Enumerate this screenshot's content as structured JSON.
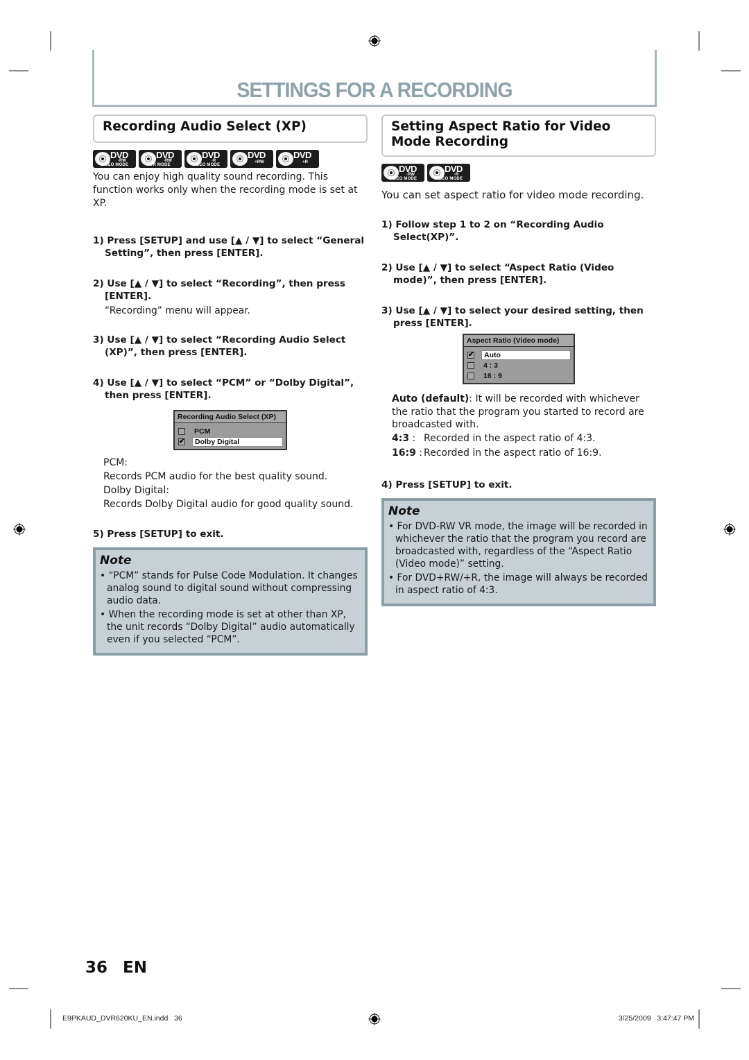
{
  "page_title": "SETTINGS FOR A RECORDING",
  "left": {
    "heading": "Recording Audio Select (XP)",
    "badges": [
      {
        "label": "DVD",
        "sub": "-RW",
        "mode": "VIDEO MODE"
      },
      {
        "label": "DVD",
        "sub": "-RW",
        "mode": "VR MODE"
      },
      {
        "label": "DVD",
        "sub": "-R",
        "mode": "VIDEO MODE"
      },
      {
        "label": "DVD",
        "sub": "+RW",
        "mode": ""
      },
      {
        "label": "DVD",
        "sub": "+R",
        "mode": ""
      }
    ],
    "intro": "You can enjoy high quality sound recording. This function works only when the recording mode is set at XP.",
    "steps": [
      {
        "text": "1) Press [SETUP] and use [▲ / ▼] to select “General Setting”, then press [ENTER].",
        "note": ""
      },
      {
        "text": "2) Use [▲ / ▼] to select “Recording”, then press [ENTER].",
        "note": "“Recording” menu will appear."
      },
      {
        "text": "3) Use [▲ / ▼] to select “Recording Audio Select (XP)”, then press [ENTER].",
        "note": ""
      },
      {
        "text": "4) Use [▲ / ▼] to select “PCM” or “Dolby Digital”, then press [ENTER].",
        "note": ""
      }
    ],
    "osd": {
      "title": "Recording Audio Select (XP)",
      "options": [
        {
          "label": "PCM",
          "checked": false,
          "selected": false
        },
        {
          "label": "Dolby Digital",
          "checked": true,
          "selected": true
        }
      ]
    },
    "definitions": [
      {
        "term": "PCM:",
        "desc": "Records PCM audio for the best quality sound."
      },
      {
        "term": "Dolby Digital:",
        "desc": "Records Dolby Digital audio for good quality sound."
      }
    ],
    "step5": "5) Press [SETUP] to exit.",
    "note": {
      "title": "Note",
      "items": [
        "“PCM” stands for Pulse Code Modulation. It changes analog sound to digital sound without compressing audio data.",
        "When the recording mode is set at other than XP, the unit records “Dolby Digital” audio automatically even if you selected “PCM”."
      ]
    }
  },
  "right": {
    "heading": "Setting Aspect Ratio for Video Mode Recording",
    "badges": [
      {
        "label": "DVD",
        "sub": "-RW",
        "mode": "VIDEO MODE"
      },
      {
        "label": "DVD",
        "sub": "-R",
        "mode": "VIDEO MODE"
      }
    ],
    "intro": "You can set aspect ratio for video mode recording.",
    "steps": [
      "1) Follow step 1 to 2 on “Recording Audio Select(XP)”.",
      "2) Use [▲ / ▼] to select “Aspect Ratio (Video mode)”, then press [ENTER].",
      "3) Use [▲ / ▼] to select your desired setting, then press [ENTER]."
    ],
    "osd": {
      "title": "Aspect Ratio (Video mode)",
      "options": [
        {
          "label": "Auto",
          "checked": true,
          "selected": true
        },
        {
          "label": "4 : 3",
          "checked": false,
          "selected": false
        },
        {
          "label": "16 : 9",
          "checked": false,
          "selected": false
        }
      ]
    },
    "auto_term": "Auto (default)",
    "auto_desc": ": It will be recorded with whichever the ratio that the program you started to record are broadcasted with.",
    "ratios": [
      {
        "key": "4:3",
        "sep": " :",
        "desc": "Recorded in the aspect ratio of 4:3."
      },
      {
        "key": "16:9",
        "sep": " :",
        "desc": "Recorded in the aspect ratio of 16:9."
      }
    ],
    "step4": "4) Press [SETUP] to exit.",
    "note": {
      "title": "Note",
      "items": [
        "For DVD-RW VR mode, the image will be recorded in whichever the ratio that the program you record are broadcasted with, regardless of the “Aspect Ratio (Video mode)” setting.",
        "For DVD+RW/+R, the image will always be recorded in aspect ratio of 4:3."
      ]
    }
  },
  "footer": {
    "page_number": "36",
    "language": "EN",
    "file": "E9PKAUD_DVR620KU_EN.indd   36",
    "date": "3/25/2009   3:47:47 PM"
  }
}
